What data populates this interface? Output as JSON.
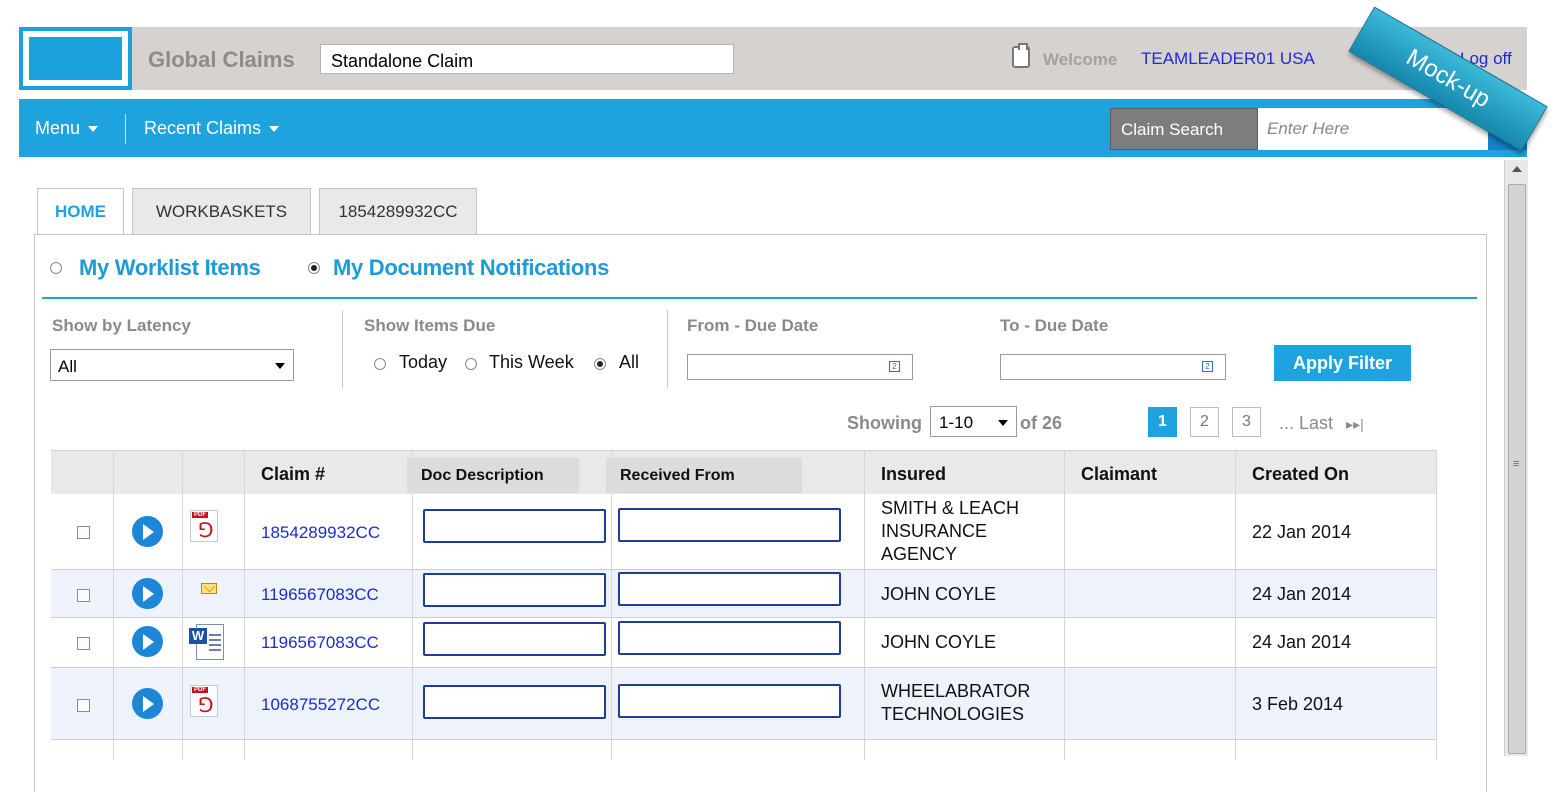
{
  "header": {
    "app_title": "Global Claims",
    "claim_type": "Standalone Claim",
    "welcome": "Welcome",
    "username": "TEAMLEADER01 USA",
    "logoff": "Log off",
    "mockup": "Mock-up"
  },
  "nav": {
    "menu": "Menu",
    "recent": "Recent Claims",
    "search_label": "Claim Search",
    "search_placeholder": "Enter Here"
  },
  "tabs": [
    {
      "label": "HOME",
      "active": true
    },
    {
      "label": "WORKBASKETS",
      "active": false
    },
    {
      "label": "1854289932CC",
      "active": false
    }
  ],
  "view": {
    "worklist": "My Worklist Items",
    "notifications": "My Document Notifications",
    "selected": "notifications"
  },
  "filters": {
    "latency_label": "Show by Latency",
    "latency_value": "All",
    "due_label": "Show Items Due",
    "due_options": [
      "Today",
      "This Week",
      "All"
    ],
    "due_selected": "All",
    "from_label": "From - Due Date",
    "to_label": "To - Due Date",
    "apply": "Apply Filter"
  },
  "pagination": {
    "showing": "Showing",
    "range": "1-10",
    "of_total": "of 26",
    "pages": [
      "1",
      "2",
      "3"
    ],
    "current": "1",
    "last": "... Last",
    "last_icon": "▸▸|"
  },
  "table": {
    "columns": [
      "",
      "",
      "",
      "Claim #",
      "Doc Description",
      "Received From",
      "Insured",
      "Claimant",
      "Created On"
    ],
    "rows": [
      {
        "doc_icon": "pdf-icon",
        "claim": "1854289932CC",
        "doc_description": "",
        "received_from": "",
        "insured": "SMITH & LEACH INSURANCE AGENCY",
        "claimant": "",
        "created_on": "22 Jan 2014"
      },
      {
        "doc_icon": "mail-icon",
        "claim": "1196567083CC",
        "doc_description": "",
        "received_from": "",
        "insured": "JOHN COYLE",
        "claimant": "",
        "created_on": "24 Jan 2014"
      },
      {
        "doc_icon": "word-icon",
        "claim": "1196567083CC",
        "doc_description": "",
        "received_from": "",
        "insured": "JOHN COYLE",
        "claimant": "",
        "created_on": "24 Jan 2014"
      },
      {
        "doc_icon": "pdf-icon",
        "claim": "1068755272CC",
        "doc_description": "",
        "received_from": "",
        "insured": "WHEELABRATOR TECHNOLOGIES",
        "claimant": "",
        "created_on": "3 Feb 2014"
      }
    ]
  },
  "colors": {
    "accent": "#1ea3df",
    "header_bg": "#d6d2cf",
    "link": "#1d2bd0",
    "alt_row": "#edf2fb"
  }
}
